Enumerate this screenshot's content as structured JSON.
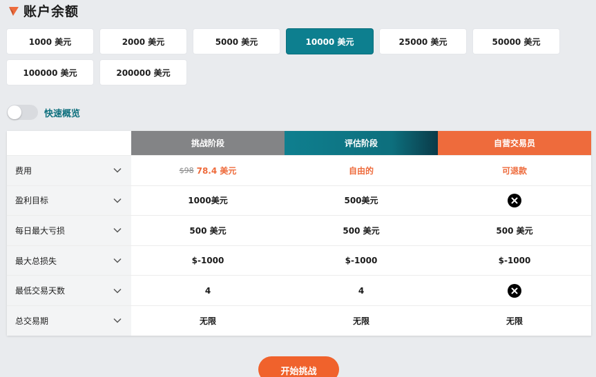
{
  "header": {
    "title": "账户余额",
    "icon": "orange-arrow-icon"
  },
  "amounts": {
    "options": [
      "1000 美元",
      "2000 美元",
      "5000 美元",
      "10000 美元",
      "25000 美元",
      "50000 美元",
      "100000 美元",
      "200000 美元"
    ],
    "selected": "10000 美元",
    "accent_color": "#0d7f8f"
  },
  "quick_view": {
    "label": "快速概览",
    "on": false
  },
  "table": {
    "columns": [
      {
        "label": "挑战阶段",
        "color": "#838486"
      },
      {
        "label": "评估阶段",
        "color": "#0d7f8f"
      },
      {
        "label": "自营交易员",
        "color": "#ee6b3c"
      }
    ],
    "rows": [
      {
        "label": "费用",
        "cells": [
          {
            "old": "$98",
            "text": "78.4 美元"
          },
          {
            "text": "自由的"
          },
          {
            "text": "可退款"
          }
        ]
      },
      {
        "label": "盈利目标",
        "cells": [
          {
            "text": "1000美元"
          },
          {
            "text": "500美元"
          },
          {
            "icon": "x-circle-icon"
          }
        ]
      },
      {
        "label": "每日最大亏损",
        "cells": [
          {
            "text": "500 美元"
          },
          {
            "text": "500 美元"
          },
          {
            "text": "500 美元"
          }
        ]
      },
      {
        "label": "最大总损失",
        "cells": [
          {
            "text": "$-1000"
          },
          {
            "text": "$-1000"
          },
          {
            "text": "$-1000"
          }
        ]
      },
      {
        "label": "最低交易天数",
        "cells": [
          {
            "text": "4"
          },
          {
            "text": "4"
          },
          {
            "icon": "x-circle-icon"
          }
        ]
      },
      {
        "label": "总交易期",
        "cells": [
          {
            "text": "无限"
          },
          {
            "text": "无限"
          },
          {
            "text": "无限"
          }
        ]
      }
    ],
    "highlight_color": "#ee6b3c"
  },
  "start_button": {
    "label": "开始挑战",
    "color": "#f0622c"
  }
}
